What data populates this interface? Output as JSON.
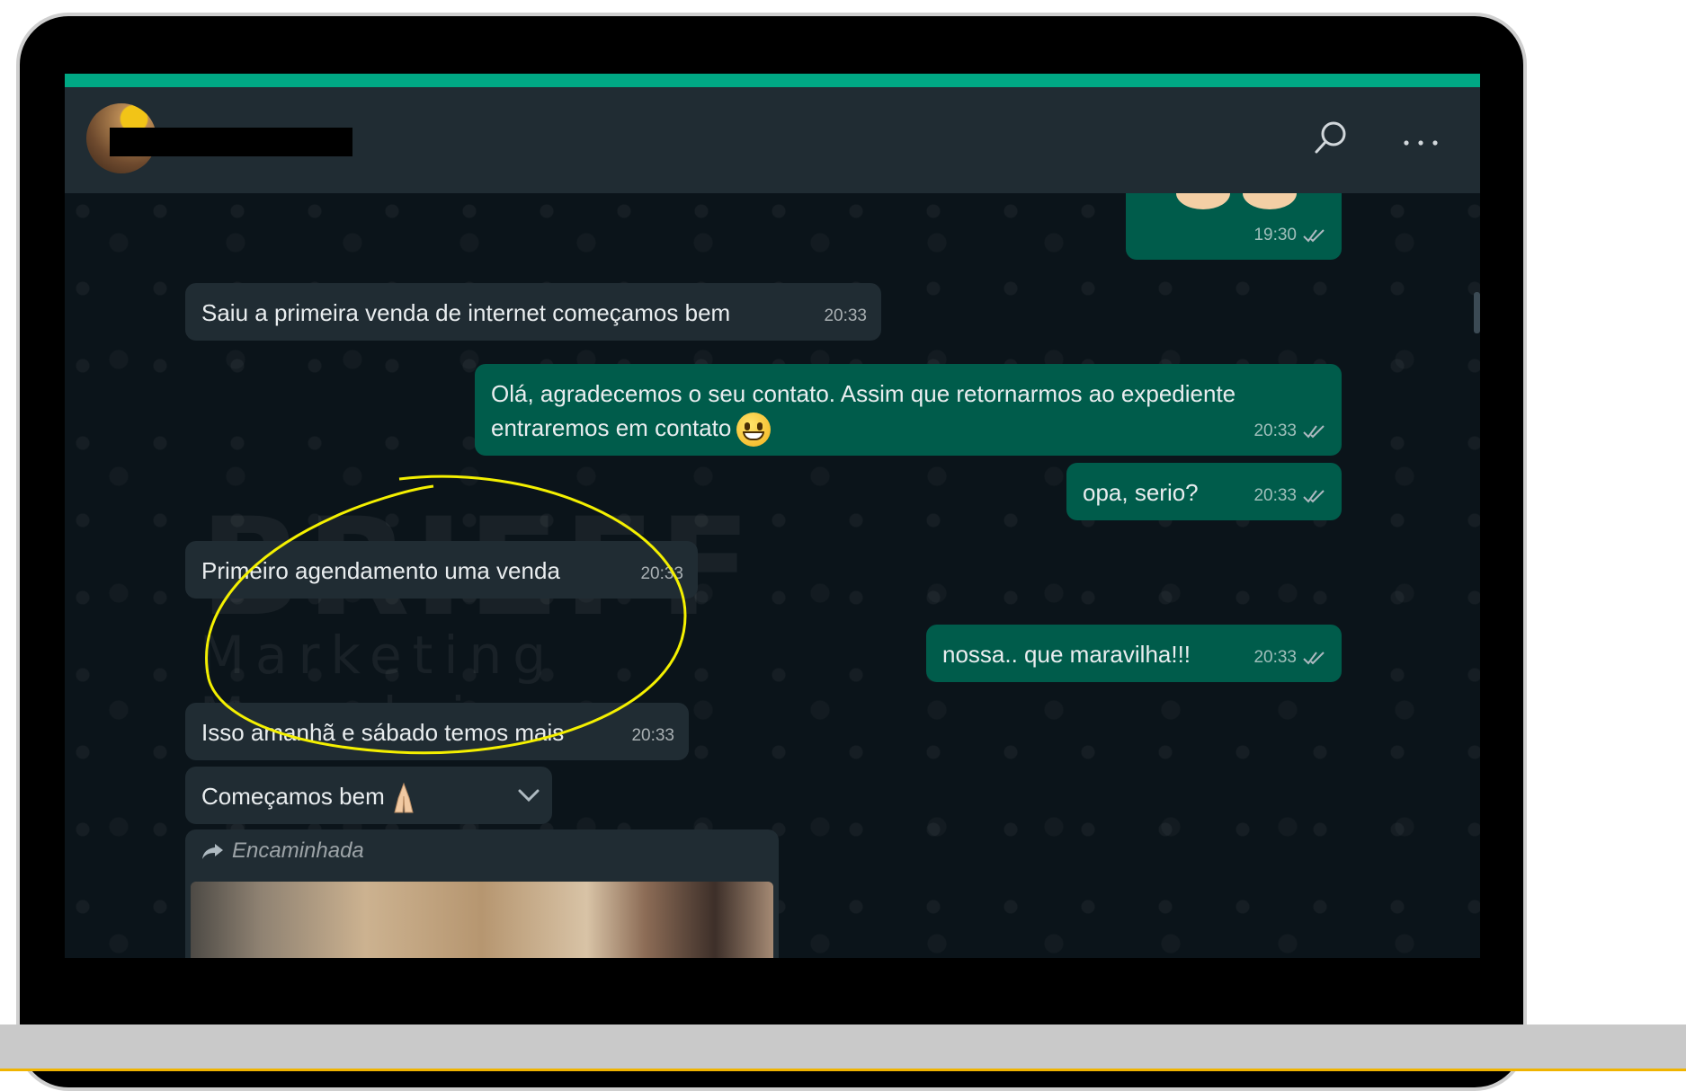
{
  "header": {
    "search_icon": "search-icon",
    "menu_icon": "more-options-icon"
  },
  "watermark": {
    "brand": "BRIEFF",
    "subtitle": "Marketing Moveleiro"
  },
  "messages": [
    {
      "direction": "outgoing",
      "text": "",
      "time": "19:30",
      "status": "double-check-icon"
    },
    {
      "direction": "incoming",
      "text": "Saiu a primeira venda de internet começamos bem",
      "time": "20:33"
    },
    {
      "direction": "outgoing",
      "text": "Olá, agradecemos o seu contato. Assim que retornarmos ao expediente entraremos em contato",
      "time": "20:33",
      "status": "double-check-icon"
    },
    {
      "direction": "outgoing",
      "text": "opa, serio?",
      "time": "20:33",
      "status": "double-check-icon"
    },
    {
      "direction": "incoming",
      "text": "Primeiro agendamento uma venda",
      "time": "20:33"
    },
    {
      "direction": "outgoing",
      "text": "nossa.. que maravilha!!!",
      "time": "20:33",
      "status": "double-check-icon"
    },
    {
      "direction": "incoming",
      "text": "Isso amanhã e sábado temos mais",
      "time": "20:33"
    },
    {
      "direction": "incoming",
      "text": "Começamos bem"
    }
  ],
  "forwarded": {
    "label": "Encaminhada"
  },
  "colors": {
    "accent": "#00a884",
    "header": "#202c33",
    "chat_bg": "#0b141a",
    "incoming": "#202c33",
    "outgoing": "#005c4b",
    "annotation": "#f4f000"
  }
}
